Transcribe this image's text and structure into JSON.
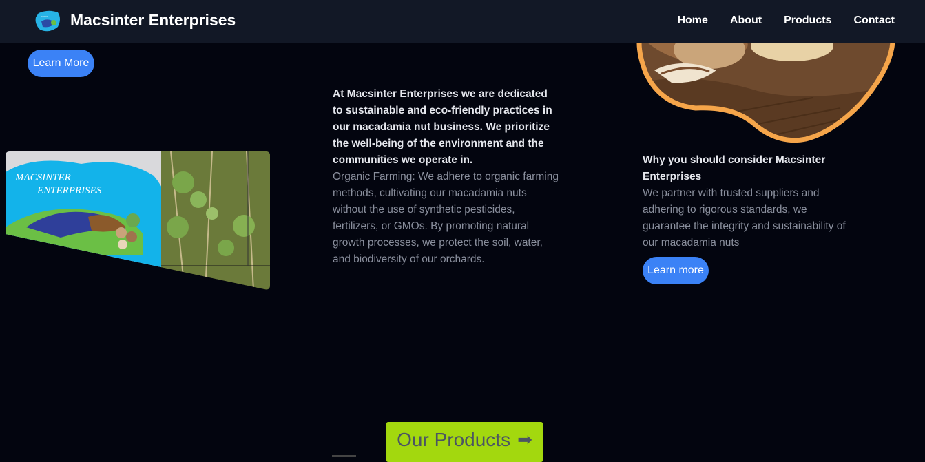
{
  "header": {
    "brand_name": "Macsinter Enterprises",
    "nav": [
      "Home",
      "About",
      "Products",
      "Contact"
    ]
  },
  "hero": {
    "learn_more_label": "Learn More"
  },
  "left_image": {
    "logo_text_line1": "MACSINTER",
    "logo_text_line2": "ENTERPRISES"
  },
  "sustainability": {
    "lead": "At Macsinter Enterprises we are dedicated to sustainable and eco-friendly practices in our macadamia nut business. We prioritize the well-being of the environment and the communities we operate in.",
    "body": "Organic Farming: We adhere to organic farming methods, cultivating our macadamia nuts without the use of synthetic pesticides, fertilizers, or GMOs. By promoting natural growth processes, we protect the soil, water, and biodiversity of our orchards."
  },
  "why": {
    "heading": "Why you should consider Macsinter Enterprises",
    "body": "We partner with trusted suppliers and adhering to rigorous standards, we guarantee the integrity and sustainability of our macadamia nuts",
    "learn_more_label": "Learn more"
  },
  "products": {
    "label": "Our Products",
    "arrow": "➡"
  },
  "colors": {
    "accent_blue": "#3b82f6",
    "products_green": "#a3d80e",
    "border_orange": "#f5a54a",
    "background": "#03050f"
  }
}
